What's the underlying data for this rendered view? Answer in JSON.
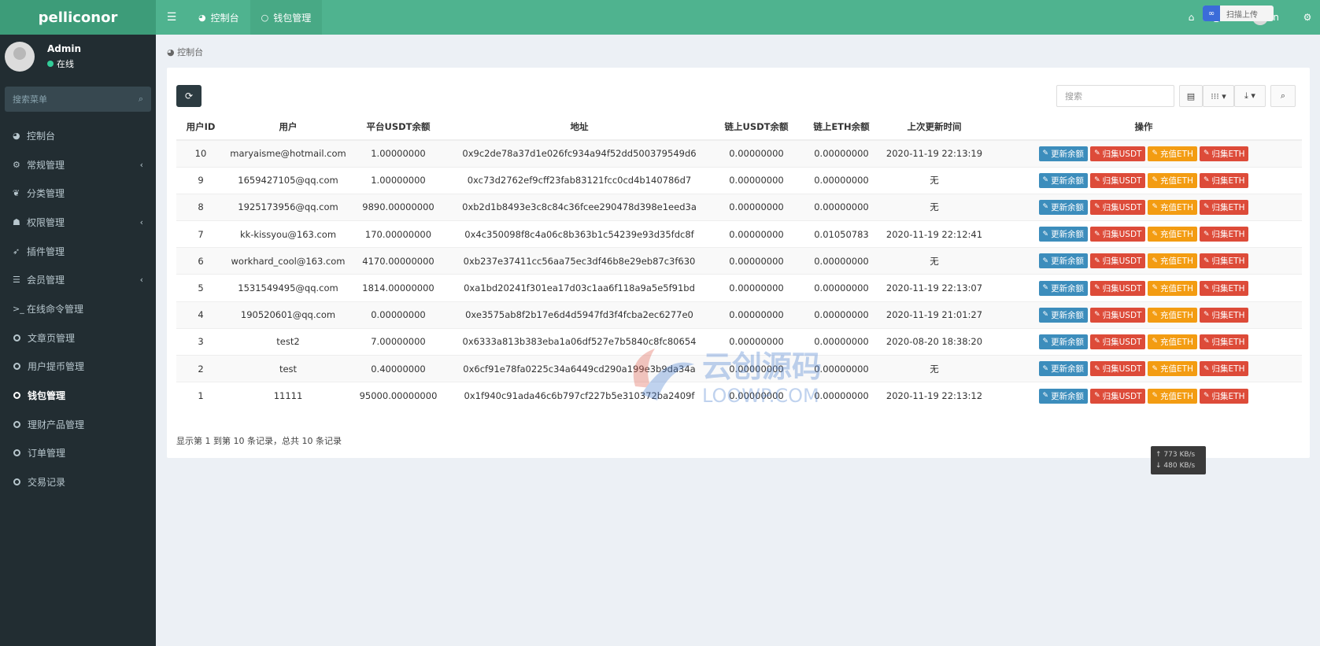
{
  "app": {
    "brand": "pelliconor"
  },
  "topbar": {
    "tabs": [
      {
        "label": "控制台"
      },
      {
        "label": "钱包管理"
      }
    ],
    "user_initial": "n",
    "qr_badge": "扫描上传"
  },
  "sidebar": {
    "user": {
      "name": "Admin",
      "status": "在线"
    },
    "search_placeholder": "搜索菜单",
    "items": [
      {
        "label": "控制台",
        "icon": "dashboard-icon"
      },
      {
        "label": "常规管理",
        "icon": "cogs-icon"
      },
      {
        "label": "分类管理",
        "icon": "leaf-icon"
      },
      {
        "label": "权限管理",
        "icon": "group-icon"
      },
      {
        "label": "插件管理",
        "icon": "rocket-icon"
      },
      {
        "label": "会员管理",
        "icon": "list-icon"
      },
      {
        "label": "在线命令管理",
        "icon": "terminal-icon"
      },
      {
        "label": "文章页管理",
        "icon": "circle-icon"
      },
      {
        "label": "用户提币管理",
        "icon": "circle-icon"
      },
      {
        "label": "钱包管理",
        "icon": "circle-icon"
      },
      {
        "label": "理财产品管理",
        "icon": "circle-icon"
      },
      {
        "label": "订单管理",
        "icon": "circle-icon"
      },
      {
        "label": "交易记录",
        "icon": "circle-icon"
      }
    ]
  },
  "breadcrumb": "控制台",
  "table": {
    "search_placeholder": "搜索",
    "columns": [
      "用户ID",
      "用户",
      "平台USDT余额",
      "地址",
      "链上USDT余额",
      "链上ETH余额",
      "上次更新时间",
      "操作"
    ],
    "actions": [
      "更新余额",
      "归集USDT",
      "充值ETH",
      "归集ETH"
    ],
    "rows": [
      {
        "id": "10",
        "user": "maryaisme@hotmail.com",
        "platform_usdt": "1.00000000",
        "address": "0x9c2de78a37d1e026fc934a94f52dd500379549d6",
        "chain_usdt": "0.00000000",
        "chain_eth": "0.00000000",
        "updated": "2020-11-19 22:13:19"
      },
      {
        "id": "9",
        "user": "1659427105@qq.com",
        "platform_usdt": "1.00000000",
        "address": "0xc73d2762ef9cff23fab83121fcc0cd4b140786d7",
        "chain_usdt": "0.00000000",
        "chain_eth": "0.00000000",
        "updated": "无"
      },
      {
        "id": "8",
        "user": "1925173956@qq.com",
        "platform_usdt": "9890.00000000",
        "address": "0xb2d1b8493e3c8c84c36fcee290478d398e1eed3a",
        "chain_usdt": "0.00000000",
        "chain_eth": "0.00000000",
        "updated": "无"
      },
      {
        "id": "7",
        "user": "kk-kissyou@163.com",
        "platform_usdt": "170.00000000",
        "address": "0x4c350098f8c4a06c8b363b1c54239e93d35fdc8f",
        "chain_usdt": "0.00000000",
        "chain_eth": "0.01050783",
        "updated": "2020-11-19 22:12:41"
      },
      {
        "id": "6",
        "user": "workhard_cool@163.com",
        "platform_usdt": "4170.00000000",
        "address": "0xb237e37411cc56aa75ec3df46b8e29eb87c3f630",
        "chain_usdt": "0.00000000",
        "chain_eth": "0.00000000",
        "updated": "无"
      },
      {
        "id": "5",
        "user": "1531549495@qq.com",
        "platform_usdt": "1814.00000000",
        "address": "0xa1bd20241f301ea17d03c1aa6f118a9a5e5f91bd",
        "chain_usdt": "0.00000000",
        "chain_eth": "0.00000000",
        "updated": "2020-11-19 22:13:07"
      },
      {
        "id": "4",
        "user": "190520601@qq.com",
        "platform_usdt": "0.00000000",
        "address": "0xe3575ab8f2b17e6d4d5947fd3f4fcba2ec6277e0",
        "chain_usdt": "0.00000000",
        "chain_eth": "0.00000000",
        "updated": "2020-11-19 21:01:27"
      },
      {
        "id": "3",
        "user": "test2",
        "platform_usdt": "7.00000000",
        "address": "0x6333a813b383eba1a06df527e7b5840c8fc80654",
        "chain_usdt": "0.00000000",
        "chain_eth": "0.00000000",
        "updated": "2020-08-20 18:38:20"
      },
      {
        "id": "2",
        "user": "test",
        "platform_usdt": "0.40000000",
        "address": "0x6cf91e78fa0225c34a6449cd290a199e3b9da34a",
        "chain_usdt": "0.00000000",
        "chain_eth": "0.00000000",
        "updated": "无"
      },
      {
        "id": "1",
        "user": "11111",
        "platform_usdt": "95000.00000000",
        "address": "0x1f940c91ada46c6b797cf227b5e310372ba2409f",
        "chain_usdt": "0.00000000",
        "chain_eth": "0.00000000",
        "updated": "2020-11-19 22:13:12"
      }
    ],
    "pager_text": "显示第 1 到第 10 条记录，总共 10 条记录"
  },
  "watermark": {
    "cn": "云创源码",
    "en": "LOOWP.COM"
  },
  "netspeed": {
    "up": "↑ 773 KB/s",
    "down": "↓ 480 KB/s"
  },
  "colors": {
    "header": "#4fb38f",
    "sidebar": "#222d32",
    "blue": "#3c8dbc",
    "red": "#dd4b39",
    "orange": "#f39c12"
  }
}
